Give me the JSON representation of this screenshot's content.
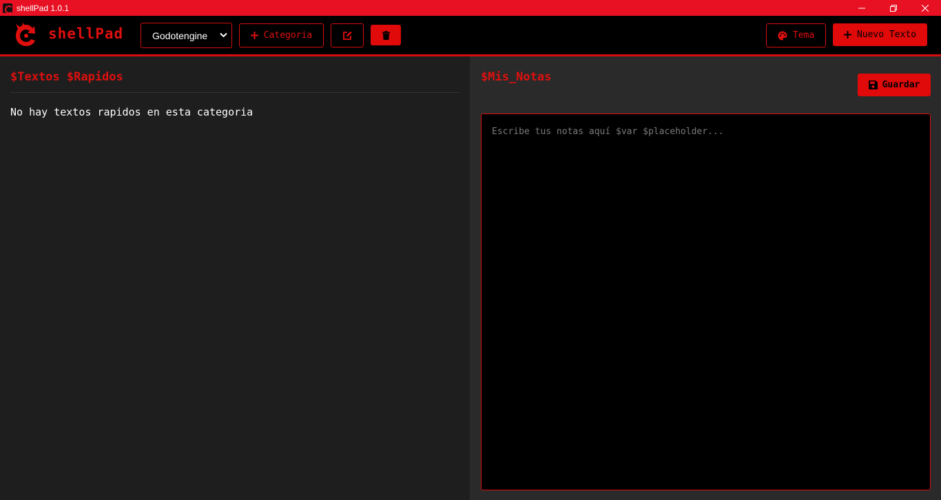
{
  "window": {
    "title": "shellPad 1.0.1",
    "controls": [
      "minimize-icon",
      "restore-icon",
      "close-icon"
    ]
  },
  "header": {
    "brand": "shellPad",
    "category_selected": "Godotengine",
    "add_category_label": "Categoria",
    "theme_label": "Tema",
    "new_text_label": "Nuevo Texto"
  },
  "left_panel": {
    "title": "$Textos $Rapidos",
    "empty_message": "No hay textos rapidos en esta categoria"
  },
  "right_panel": {
    "title": "$Mis_Notas",
    "save_label": "Guardar",
    "notes_placeholder": "Escribe tus notas aquí $var $placeholder...",
    "notes_value": ""
  },
  "colors": {
    "accent": "#e00f0f",
    "titlebar": "#e81123",
    "header_bg": "#000000",
    "left_bg": "#1e1e1e",
    "right_bg": "#2a2a2a"
  }
}
